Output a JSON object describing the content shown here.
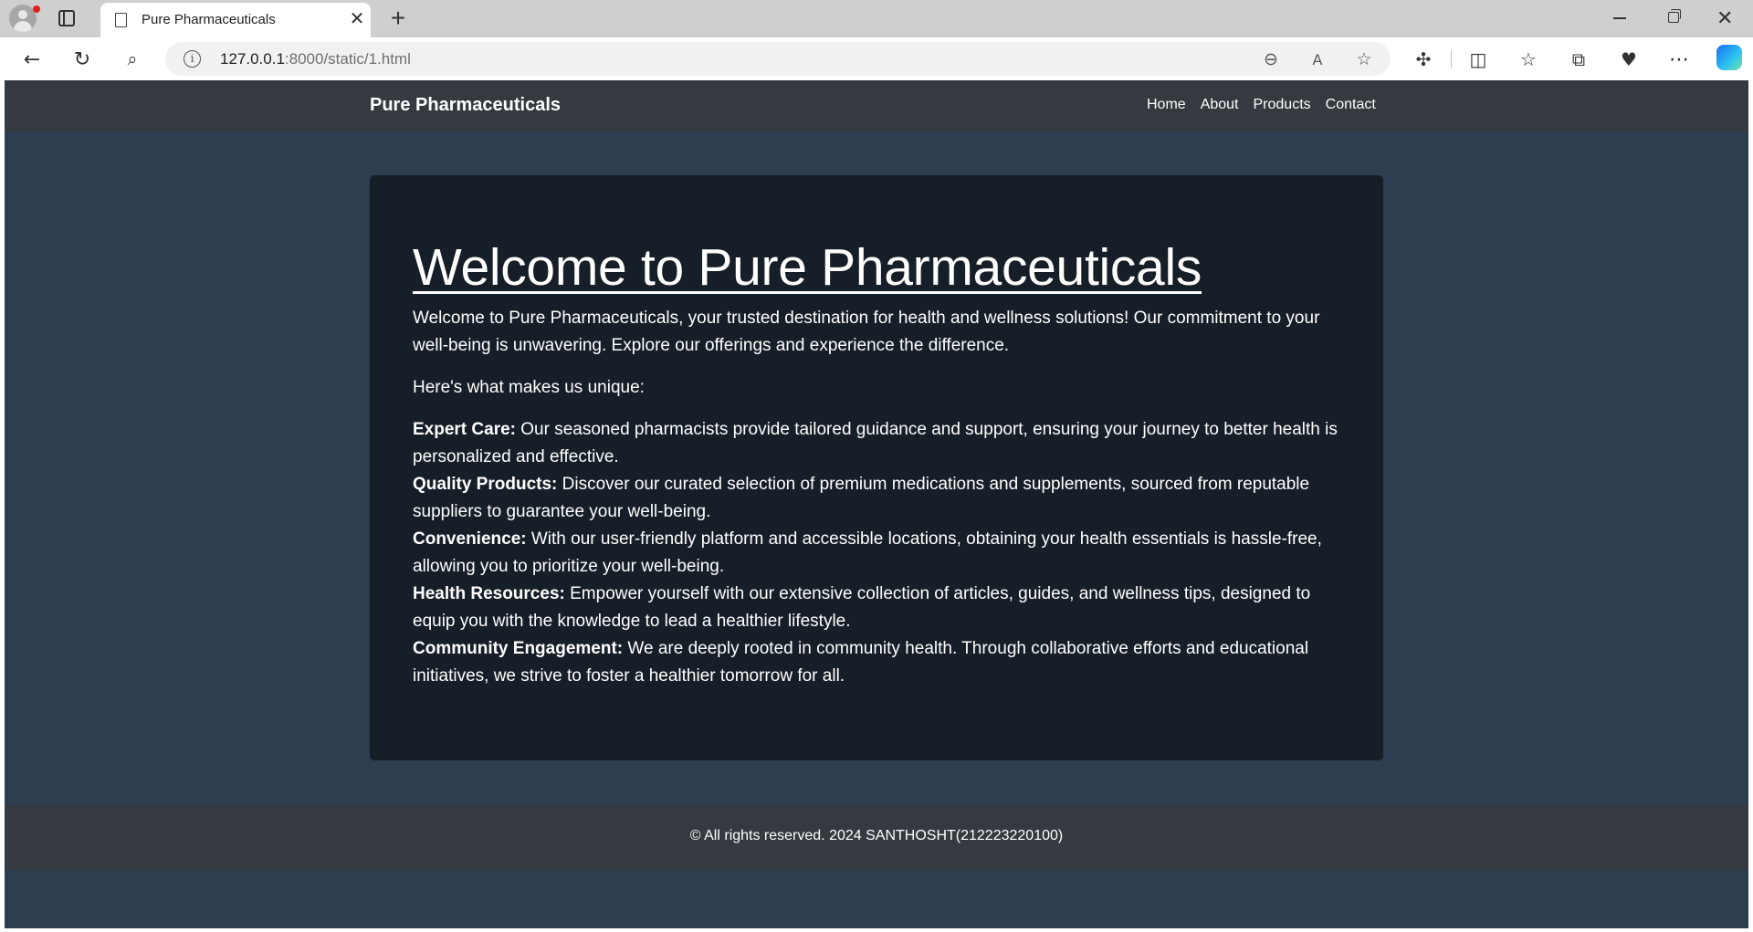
{
  "browser": {
    "tab_title": "Pure Pharmaceuticals",
    "url_host": "127.0.0.1",
    "url_rest": ":8000/static/1.html"
  },
  "site": {
    "brand": "Pure Pharmaceuticals",
    "nav": [
      "Home",
      "About",
      "Products",
      "Contact"
    ]
  },
  "main": {
    "title": "Welcome to Pure Pharmaceuticals",
    "intro": "Welcome to Pure Pharmaceuticals, your trusted destination for health and wellness solutions! Our commitment to your well-being is unwavering. Explore our offerings and experience the difference.",
    "lead": "Here's what makes us unique:",
    "features": [
      {
        "name": "Expert Care:",
        "text": " Our seasoned pharmacists provide tailored guidance and support, ensuring your journey to better health is personalized and effective."
      },
      {
        "name": "Quality Products:",
        "text": " Discover our curated selection of premium medications and supplements, sourced from reputable suppliers to guarantee your well-being."
      },
      {
        "name": "Convenience:",
        "text": " With our user-friendly platform and accessible locations, obtaining your health essentials is hassle-free, allowing you to prioritize your well-being."
      },
      {
        "name": "Health Resources:",
        "text": " Empower yourself with our extensive collection of articles, guides, and wellness tips, designed to equip you with the knowledge to lead a healthier lifestyle."
      },
      {
        "name": "Community Engagement:",
        "text": " We are deeply rooted in community health. Through collaborative efforts and educational initiatives, we strive to foster a healthier tomorrow for all."
      }
    ]
  },
  "footer": {
    "text": "© All rights reserved. 2024 SANTHOSHT(212223220100)"
  },
  "colors": {
    "page_bg": "#2c3e50",
    "navbar_bg": "#343a40",
    "card_bg": "#161e27"
  }
}
